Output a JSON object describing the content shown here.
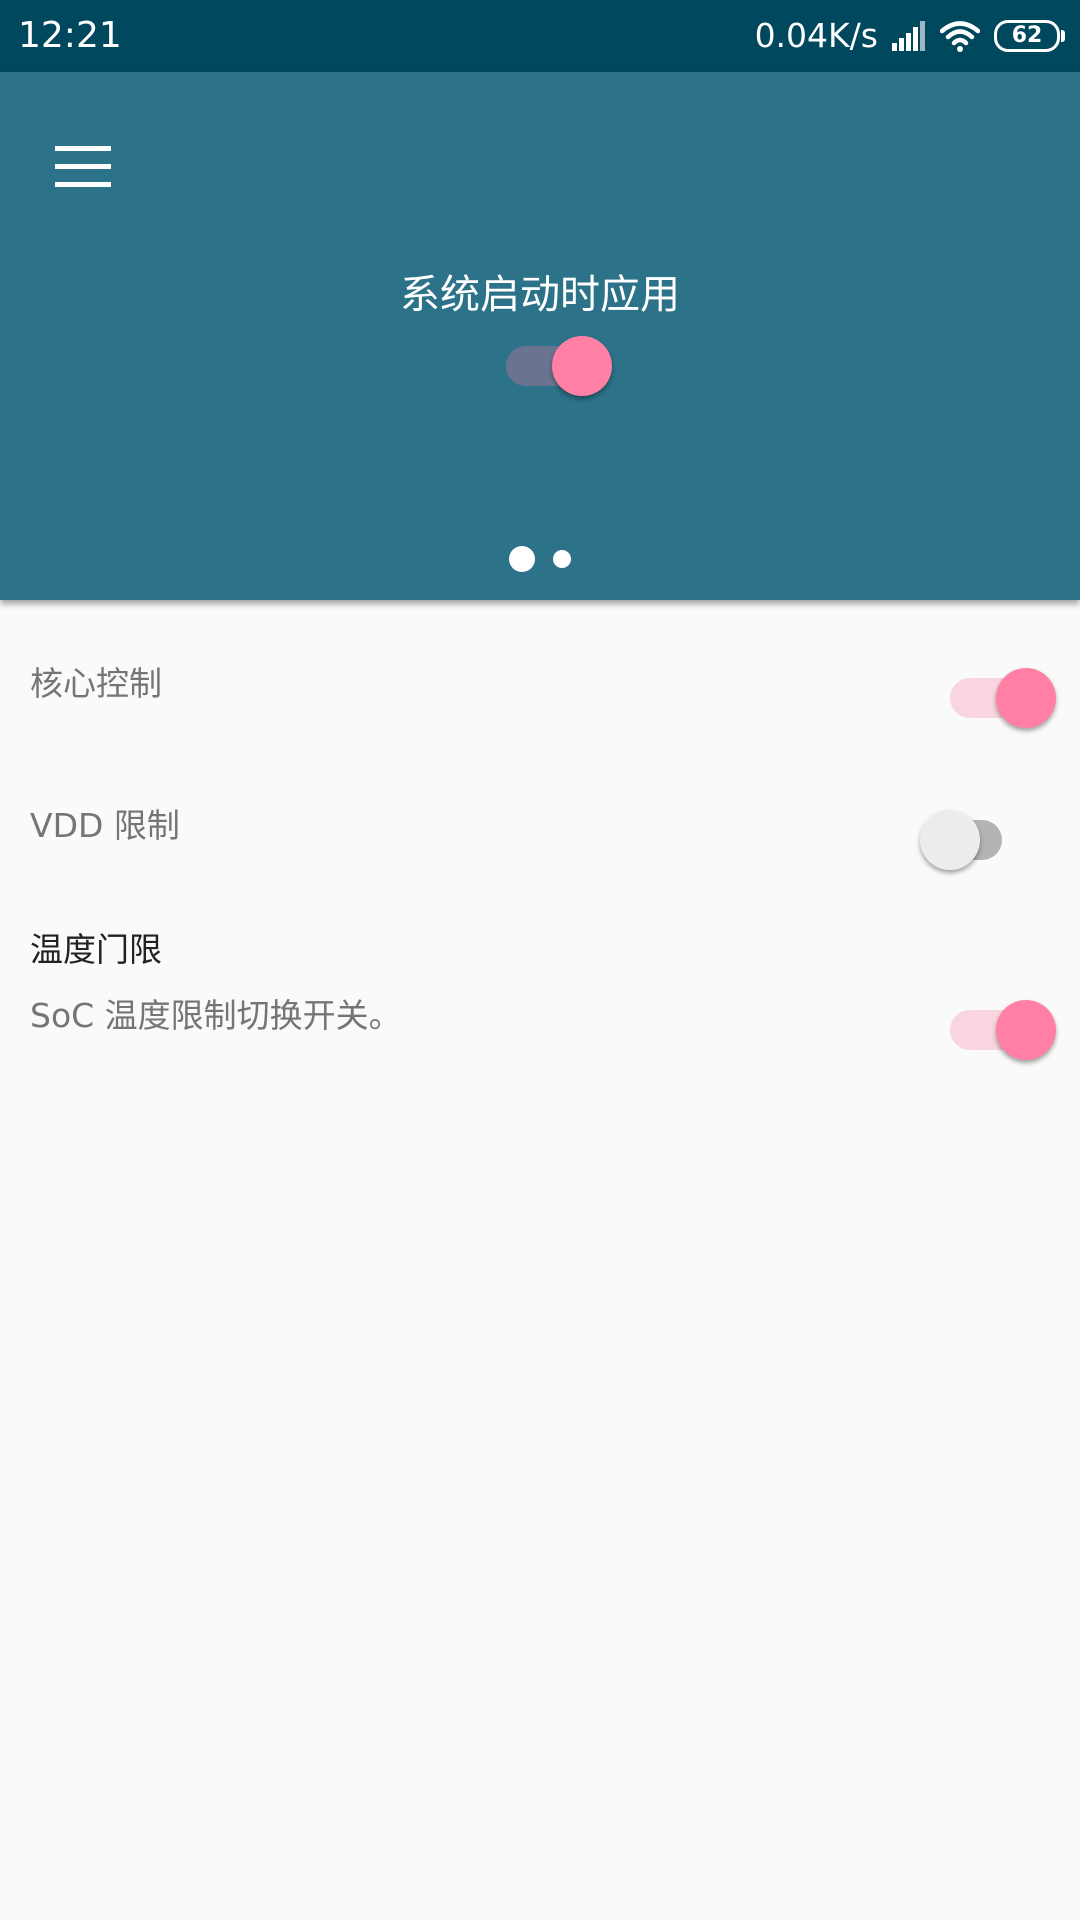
{
  "status_bar": {
    "time": "12:21",
    "net_speed": "0.04K/s",
    "battery": "62",
    "icons": [
      "signal-icon",
      "wifi-icon",
      "battery-icon"
    ]
  },
  "header": {
    "menu_icon": "hamburger-menu-icon",
    "title": "系统启动时应用",
    "switch_on": true,
    "page_indicator": {
      "count": 2,
      "active": 0
    }
  },
  "settings": [
    {
      "title": "核心控制",
      "summary": "",
      "enabled": true
    },
    {
      "title": "VDD 限制",
      "summary": "",
      "enabled": false
    },
    {
      "title": "温度门限",
      "summary": "SoC 温度限制切换开关。",
      "enabled": true
    }
  ],
  "colors": {
    "status_bar": "#00485d",
    "header": "#2c7288",
    "accent": "#ff80a4",
    "background": "#fafafa"
  }
}
